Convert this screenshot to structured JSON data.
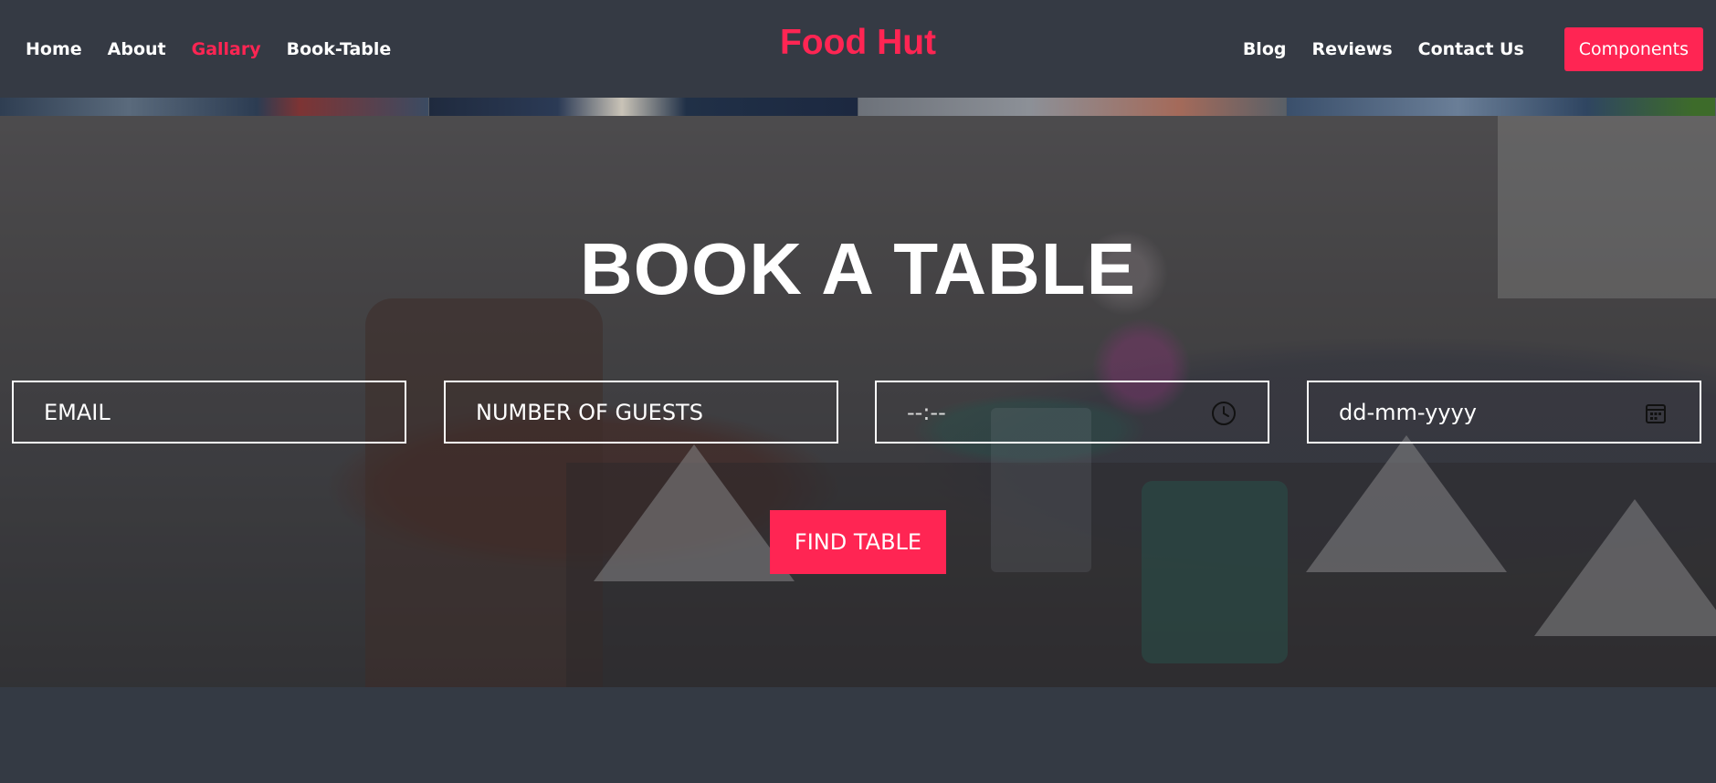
{
  "header": {
    "brand": "Food Hut",
    "nav_left": [
      {
        "label": "Home",
        "active": false
      },
      {
        "label": "About",
        "active": false
      },
      {
        "label": "Gallary",
        "active": true
      },
      {
        "label": "Book-Table",
        "active": false
      }
    ],
    "nav_right": [
      {
        "label": "Blog"
      },
      {
        "label": "Reviews"
      },
      {
        "label": "Contact Us"
      }
    ],
    "components_button": "Components"
  },
  "booking": {
    "title": "BOOK A TABLE",
    "email_placeholder": "EMAIL",
    "guests_placeholder": "NUMBER OF GUESTS",
    "time_value": "--:--",
    "date_value": "dd-mm-yyyy",
    "submit_label": "FIND TABLE"
  },
  "colors": {
    "accent": "#ff2553",
    "background": "#343a44",
    "text": "#ffffff"
  },
  "icons": {
    "time": "clock-icon",
    "date": "calendar-icon"
  }
}
